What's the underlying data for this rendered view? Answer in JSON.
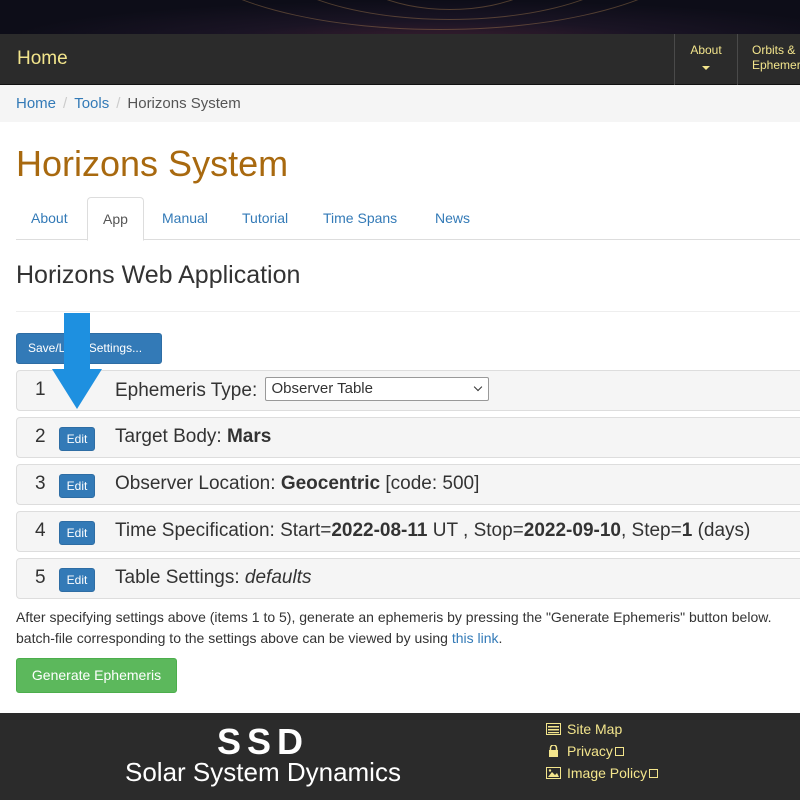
{
  "navbar": {
    "home": "Home",
    "about": "About",
    "orbits": "Orbits & Ephemer"
  },
  "breadcrumb": {
    "home": "Home",
    "tools": "Tools",
    "current": "Horizons System"
  },
  "page_title": "Horizons System",
  "tabs": [
    "About",
    "App",
    "Manual",
    "Tutorial",
    "Time Spans",
    "News"
  ],
  "app_title": "Horizons Web Application",
  "save_button": "Save/Load Settings...",
  "edit_label": "Edit",
  "settings": {
    "s1": {
      "num": "1",
      "label": "Ephemeris Type:",
      "value": "Observer Table"
    },
    "s2": {
      "num": "2",
      "label": "Target Body:",
      "value": "Mars"
    },
    "s3": {
      "num": "3",
      "label": "Observer Location:",
      "value": "Geocentric",
      "extra": "[code: 500]"
    },
    "s4": {
      "num": "4",
      "label": "Time Specification:",
      "p1": "Start=",
      "start": "2022-08-11",
      "p2": "UT , Stop=",
      "stop": "2022-09-10",
      "p3": ", Step=",
      "step": "1",
      "p4": "(days)"
    },
    "s5": {
      "num": "5",
      "label": "Table Settings:",
      "value": "defaults"
    }
  },
  "instructions": {
    "line1": "After specifying settings above (items 1 to 5), generate an ephemeris by pressing the \"Generate Ephemeris\" button below.",
    "line2": "batch-file corresponding to the settings above can be viewed by using",
    "link": "this link",
    "end": "."
  },
  "generate_button": "Generate Ephemeris",
  "footer": {
    "logo": "SSD",
    "name": "Solar System Dynamics",
    "links": [
      "Site Map",
      "Privacy",
      "Image Policy"
    ]
  },
  "colors": {
    "accent": "#337ab7",
    "title": "#a8690f",
    "nav_text": "#f3e58c",
    "success": "#5cb85c",
    "arrow": "#1e90e0"
  }
}
